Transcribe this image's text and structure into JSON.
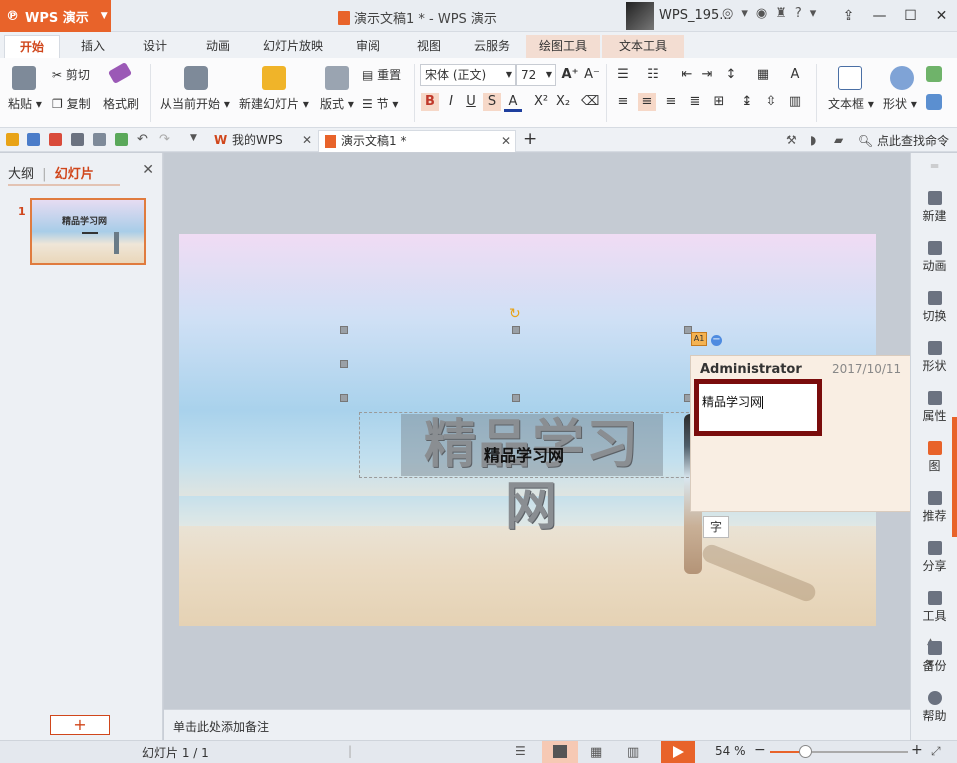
{
  "app": {
    "logo_label": "WPS 演示",
    "window_title": "演示文稿1 * - WPS 演示",
    "user_name": "WPS_195...",
    "help_label": "?"
  },
  "menu": {
    "tabs": [
      "开始",
      "插入",
      "设计",
      "动画",
      "幻灯片放映",
      "审阅",
      "视图",
      "云服务",
      "绘图工具",
      "文本工具"
    ],
    "active_tab": "开始"
  },
  "ribbon": {
    "paste": "粘贴",
    "cut": "剪切",
    "copy": "复制",
    "format_painter": "格式刷",
    "from_current": "从当前开始",
    "new_slide": "新建幻灯片",
    "layout": "版式",
    "reset": "重置",
    "section": "节",
    "font_name": "宋体 (正文)",
    "font_size": "72",
    "bold": "B",
    "italic": "I",
    "underline": "U",
    "shadow": "S",
    "font_color": "A",
    "superscript": "X²",
    "subscript": "X₂",
    "textbox": "文本框",
    "shape": "形状"
  },
  "quickbar": {
    "doc_tabs": [
      {
        "label": "我的WPS",
        "active": false
      },
      {
        "label": "演示文稿1 *",
        "active": true
      }
    ],
    "add_tab": "+",
    "find_command": "点此查找命令"
  },
  "left_panel": {
    "tab_outline": "大纲",
    "tab_slides": "幻灯片",
    "thumb_number": "1",
    "thumb_title": "精品学习网",
    "add_button": "+"
  },
  "slide": {
    "title": "精品学习网",
    "subtitle": "精品学习网",
    "comment_marker": "A1",
    "comment_minus": "−"
  },
  "comment": {
    "author": "Administrator",
    "date": "2017/10/11",
    "text": "精品学习网",
    "close": "×",
    "zi_button": "字"
  },
  "notes": {
    "placeholder": "单击此处添加备注"
  },
  "right_sidebar": {
    "items": [
      "新建",
      "动画",
      "切换",
      "形状",
      "属性",
      "图",
      "推荐",
      "分享",
      "工具",
      "备份",
      "帮助"
    ]
  },
  "status": {
    "slide_info": "幻灯片 1 / 1",
    "zoom_label": "54 %",
    "zoom_fraction": 0.25
  },
  "colors": {
    "accent": "#e8632a",
    "active_tab_text": "#d0461b",
    "comment_border": "#7a0c0c"
  }
}
